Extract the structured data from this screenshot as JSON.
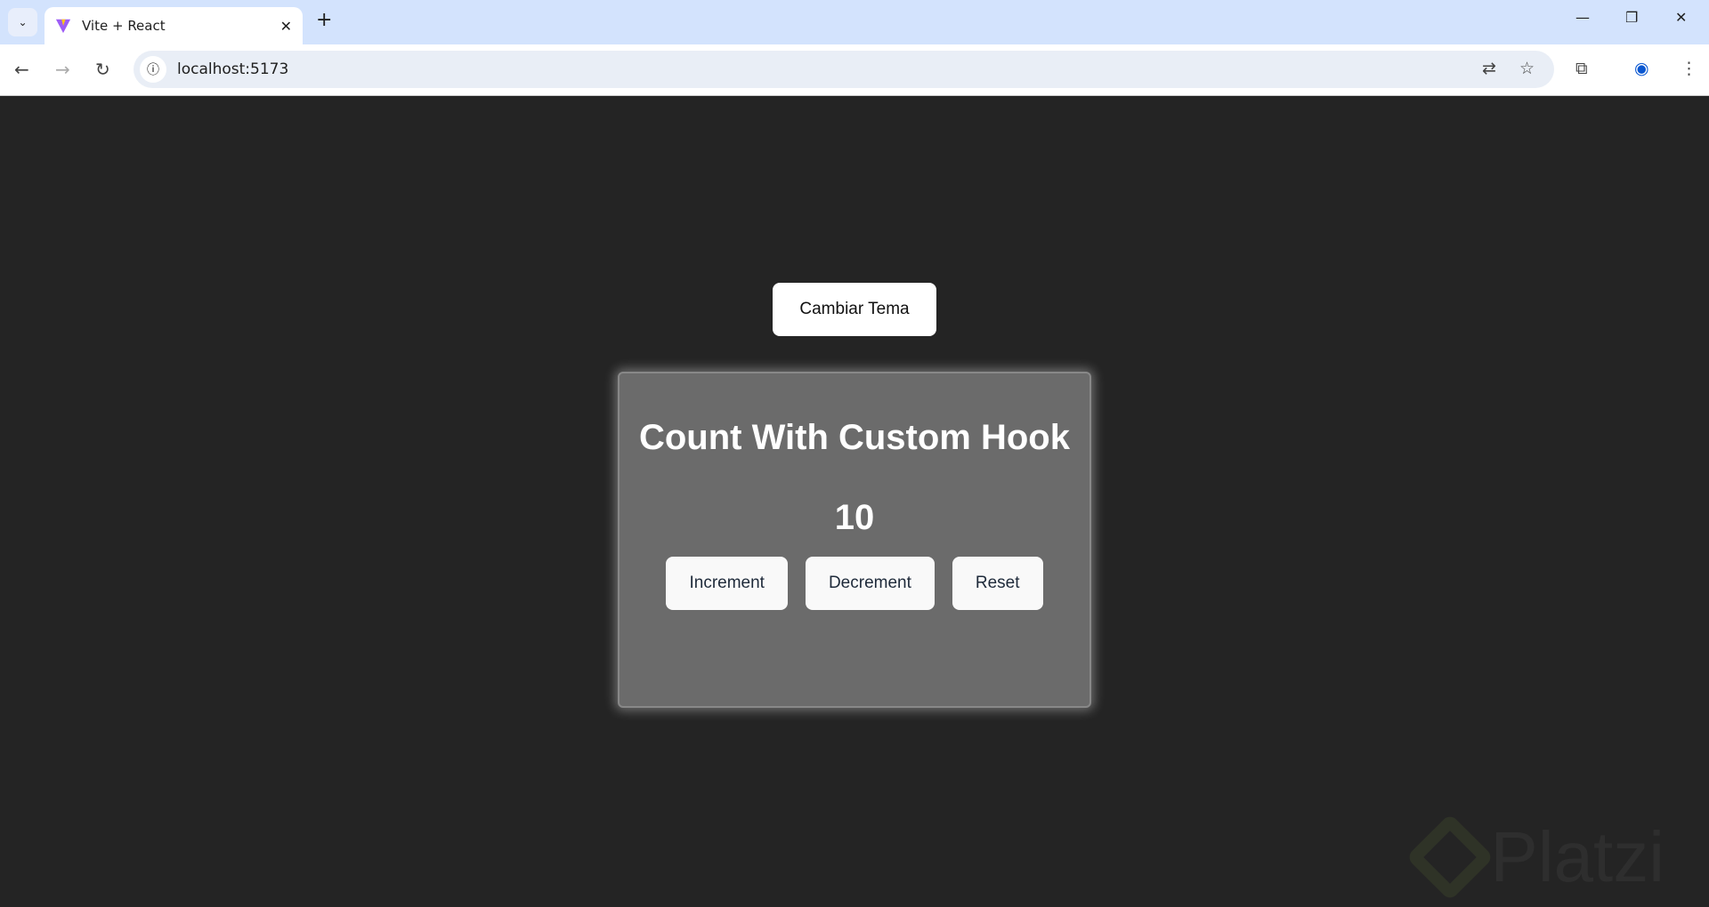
{
  "browser": {
    "tab_title": "Vite + React",
    "url": "localhost:5173"
  },
  "page": {
    "theme_button": "Cambiar Tema",
    "card_title": "Count With Custom Hook",
    "count": "10",
    "buttons": {
      "increment": "Increment",
      "decrement": "Decrement",
      "reset": "Reset"
    }
  },
  "watermark": "Platzi"
}
